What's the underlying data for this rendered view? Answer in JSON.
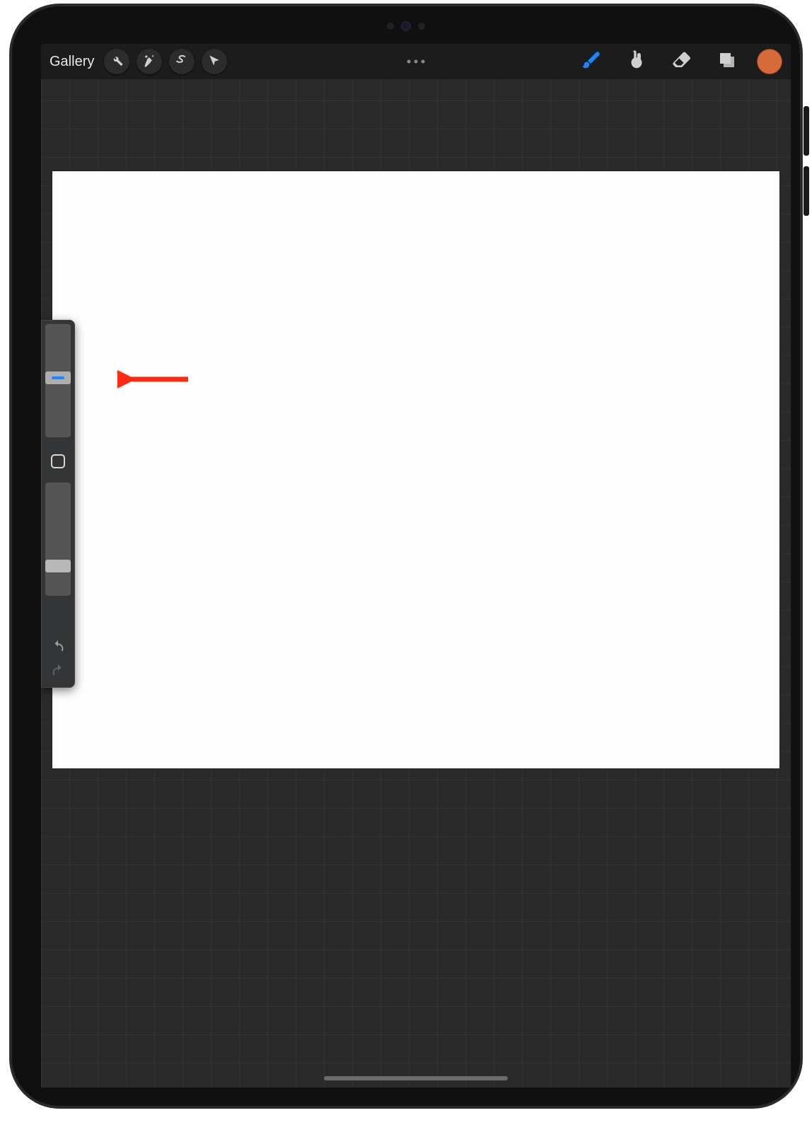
{
  "toolbar": {
    "gallery_label": "Gallery",
    "icons": {
      "actions": "wrench-icon",
      "adjustments": "wand-icon",
      "selection": "s-ribbon-icon",
      "transform": "arrow-icon",
      "menu": "ellipsis-icon",
      "brush": "brush-icon",
      "smudge": "smudge-icon",
      "eraser": "eraser-icon",
      "layers": "layers-icon",
      "color": "color-swatch"
    },
    "active_tool": "brush",
    "brush_color_active": "#1a86ff",
    "color_swatch_value": "#d86a3a"
  },
  "sidebar": {
    "brush_size_slider": {
      "position_percent": 42,
      "accent": "#1a86ff"
    },
    "modify_button": "square-icon",
    "opacity_slider": {
      "position_percent": 78
    },
    "undo": "undo-icon",
    "redo": "redo-icon",
    "redo_enabled": false
  },
  "canvas": {
    "background": "#fefefe"
  },
  "annotation": {
    "target": "brush-size-slider-thumb",
    "color": "#ff2a12"
  }
}
